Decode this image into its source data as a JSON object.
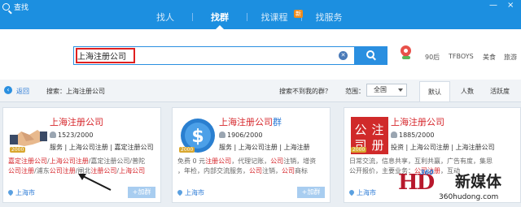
{
  "window": {
    "title": "查找",
    "minimize": "—",
    "close": "×"
  },
  "nav": {
    "tabs": [
      "找人",
      "找群",
      "找课程",
      "找服务"
    ],
    "active": "找群",
    "new_badge": "新"
  },
  "search": {
    "value": "上海注册公司",
    "clear_icon": "clear-icon",
    "button_icon": "search-icon"
  },
  "hot_searches": [
    "90后",
    "TFBOYS",
    "美食",
    "旅游"
  ],
  "filter": {
    "back": "返回",
    "search_prefix": "搜索：上海注册公司",
    "not_found": "搜索不到我的群？",
    "range_label": "范围：",
    "range_value": "全国",
    "sort": [
      "默认",
      "人数",
      "活跃度"
    ],
    "sort_active": "默认"
  },
  "cards": [
    {
      "title": "上海注册公司",
      "title_suffix": "",
      "members": "1523/2000",
      "tags": "服务 | 上海公司注册 | 嘉定注册公司",
      "desc1": [
        [
          "r",
          "嘉定注册公司"
        ],
        [
          "t",
          "/"
        ],
        [
          "r",
          "上海公司注册"
        ],
        [
          "t",
          "/嘉定注册公司/普陀"
        ]
      ],
      "desc2": [
        [
          "r",
          "公司注册"
        ],
        [
          "t",
          "/浦东"
        ],
        [
          "r",
          "公司注册"
        ],
        [
          "t",
          "/闸北"
        ],
        [
          "r",
          "注册公司"
        ],
        [
          "t",
          "/"
        ],
        [
          "r",
          "上海公司"
        ]
      ],
      "city": "上海市",
      "join": "+加群",
      "level": "2000"
    },
    {
      "title": "上海注册公司",
      "title_suffix": "群",
      "members": "1906/2000",
      "tags": "服务 | 上海公司注册 | 上海注册",
      "desc1": [
        [
          "t",
          "免费 0 元"
        ],
        [
          "r",
          "注册公司"
        ],
        [
          "t",
          "，代理记账，"
        ],
        [
          "r",
          "公司"
        ],
        [
          "t",
          "注销，增资"
        ]
      ],
      "desc2": [
        [
          "t",
          "，年检，内部交流服务，"
        ],
        [
          "r",
          "公司"
        ],
        [
          "t",
          "注销，"
        ],
        [
          "r",
          "公司"
        ],
        [
          "t",
          "商标"
        ]
      ],
      "city": "上海市",
      "join": "+加群",
      "level": "2000"
    },
    {
      "title": "上海注册公司",
      "title_suffix": "",
      "members": "1885/2000",
      "tags": "投资 | 上海公司注册 | 上海注册公司",
      "desc1": [
        [
          "t",
          "日常交流，信息共享，互利共赢，广告有度，集思"
        ]
      ],
      "desc2": [
        [
          "t",
          "公开报价，主要业务："
        ],
        [
          "r",
          "公司注册"
        ],
        [
          "t",
          "，互动"
        ]
      ],
      "city": "上海市",
      "join": "+加群",
      "level": "2000"
    }
  ],
  "watermark": {
    "hd": "HD",
    "n360": "360",
    "site_name": "新媒体",
    "url": "360hudong.com"
  },
  "colors": {
    "accent": "#1c8fe0",
    "highlight": "#d6262b",
    "link": "#2a7ad6"
  }
}
